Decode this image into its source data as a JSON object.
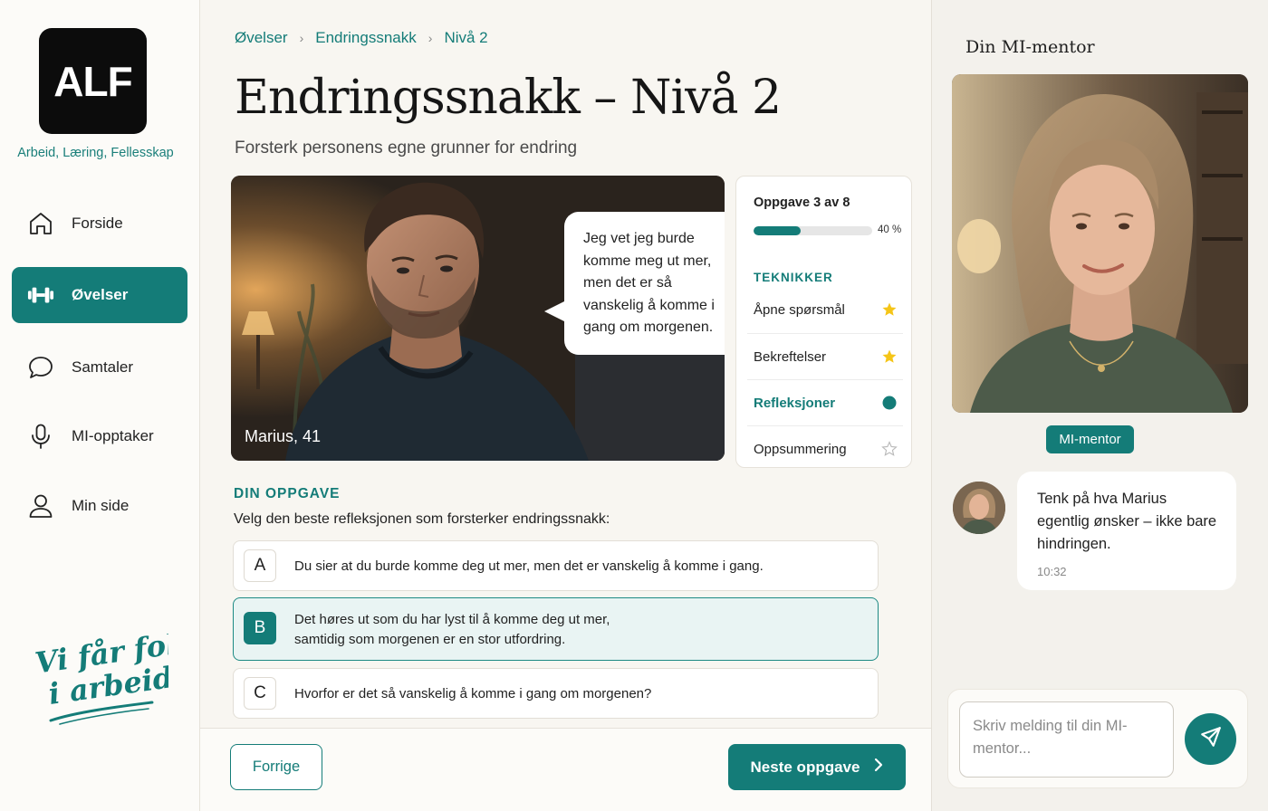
{
  "brand": {
    "logo_text": "ALF",
    "tagline": "Arbeid, Læring, Fellesskap",
    "slogan_line1": "Vi får folk",
    "slogan_line2": "i arbeid!"
  },
  "sidebar": {
    "items": [
      {
        "label": "Forside",
        "icon": "home-icon",
        "active": false
      },
      {
        "label": "Øvelser",
        "icon": "dumbbell-icon",
        "active": true
      },
      {
        "label": "Samtaler",
        "icon": "chat-bubble-icon",
        "active": false
      },
      {
        "label": "MI-opptaker",
        "icon": "microphone-icon",
        "active": false
      },
      {
        "label": "Min side",
        "icon": "user-icon",
        "active": false
      }
    ]
  },
  "breadcrumb": [
    "Øvelser",
    "Endringssnakk",
    "Nivå 2"
  ],
  "page": {
    "title": "Endringssnakk – Nivå 2",
    "subtitle": "Forsterk personens egne grunner for endring"
  },
  "scene": {
    "quote": "Jeg vet jeg burde komme meg ut mer, men det er så vanskelig å komme i gang om morgenen.",
    "person": "Marius, 41"
  },
  "progress": {
    "task_label": "Oppgave 3 av 8",
    "percent": 40,
    "percent_label": "40 %",
    "techniques_heading": "TEKNIKKER",
    "techniques": [
      {
        "label": "Åpne spørsmål",
        "status": "done",
        "icon": "star-filled-icon"
      },
      {
        "label": "Bekreftelser",
        "status": "done",
        "icon": "star-filled-icon"
      },
      {
        "label": "Refleksjoner",
        "status": "current",
        "icon": "dot-icon"
      },
      {
        "label": "Oppsummering",
        "status": "todo",
        "icon": "star-outline-icon"
      }
    ]
  },
  "task": {
    "heading": "DIN OPPGAVE",
    "instruction": "Velg den beste refleksjonen som forsterker endringssnakk:",
    "options": [
      {
        "letter": "A",
        "text": "Du sier at du burde komme deg ut mer, men det er vanskelig å komme i gang.",
        "selected": false
      },
      {
        "letter": "B",
        "text": "Det høres ut som du har lyst til å komme deg ut mer,\nsamtidig som morgenen er en stor utfordring.",
        "selected": true
      },
      {
        "letter": "C",
        "text": "Hvorfor er det så vanskelig å komme i gang om morgenen?",
        "selected": false
      }
    ]
  },
  "footer": {
    "prev_label": "Forrige",
    "next_label": "Neste oppgave"
  },
  "mentor": {
    "panel_title": "Din MI-mentor",
    "badge": "MI-mentor",
    "message": "Tenk på hva Marius egentlig ønsker – ikke bare hindringen.",
    "time": "10:32",
    "input_placeholder": "Skriv melding til din MI-mentor..."
  },
  "colors": {
    "accent": "#147c78",
    "selected_bg": "#e9f4f3",
    "star": "#f5c518"
  }
}
